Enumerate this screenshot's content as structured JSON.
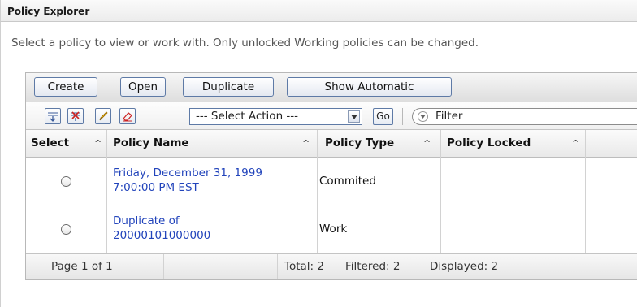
{
  "panel": {
    "title": "Policy Explorer"
  },
  "intro_text": "Select a policy to view or work with. Only unlocked Working policies can be changed.",
  "buttons": {
    "create": "Create",
    "open": "Open",
    "duplicate": "Duplicate",
    "show_automatic": "Show Automatic"
  },
  "toolbar": {
    "icons": [
      "expand-all-icon",
      "collapse-all-icon",
      "edit-icon",
      "clear-icon"
    ],
    "select_action": "--- Select Action ---",
    "go": "Go",
    "filter_placeholder": "Filter"
  },
  "table": {
    "columns": [
      "Select",
      "Policy Name",
      "Policy Type",
      "Policy Locked"
    ],
    "rows": [
      {
        "name_line1": "Friday, December 31, 1999",
        "name_line2": "7:00:00 PM EST",
        "type": "Commited",
        "locked": ""
      },
      {
        "name_line1": "Duplicate of",
        "name_line2": "20000101000000",
        "type": "Work",
        "locked": ""
      }
    ]
  },
  "footer": {
    "page": "Page 1 of 1",
    "total": "Total: 2",
    "filtered": "Filtered: 2",
    "displayed": "Displayed: 2"
  }
}
